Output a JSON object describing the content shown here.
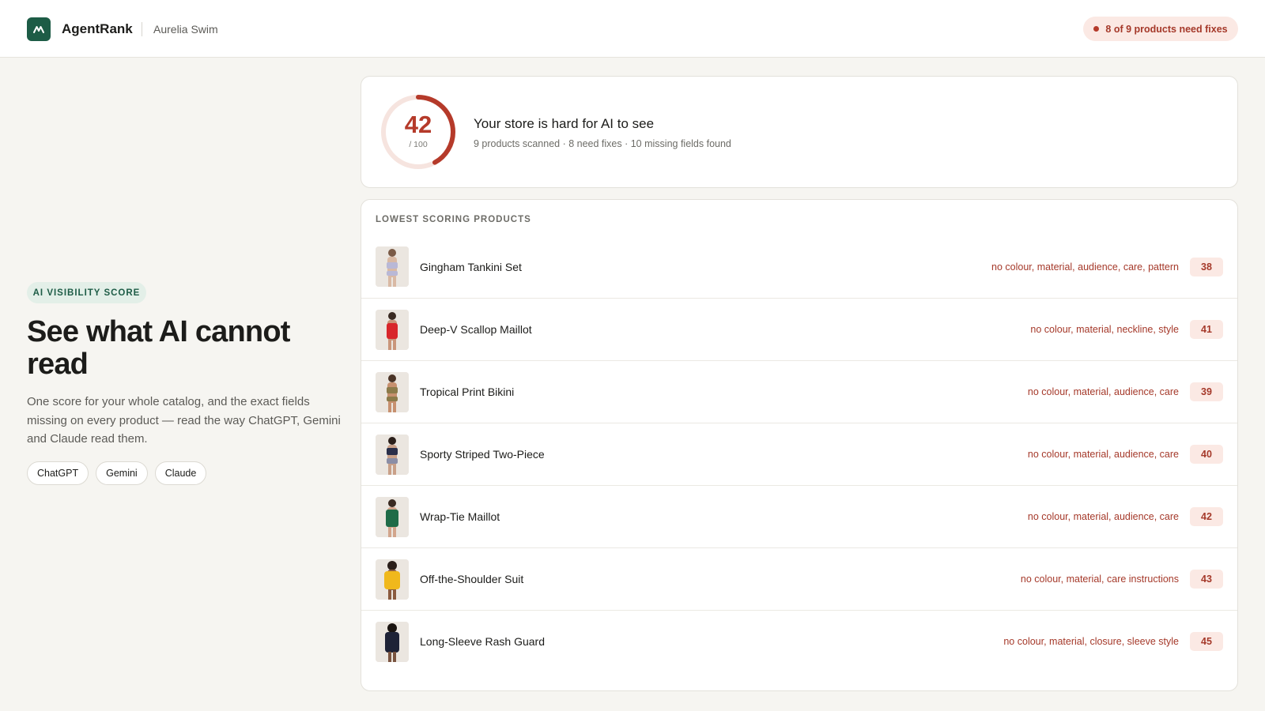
{
  "header": {
    "brand": "AgentRank",
    "store_name": "Aurelia Swim",
    "alert": "8 of 9 products need fixes"
  },
  "hero": {
    "eyebrow": "AI VISIBILITY SCORE",
    "title": "See what AI cannot read",
    "description": "One score for your whole catalog, and the exact fields missing on every product — read the way ChatGPT, Gemini and Claude read them.",
    "models": [
      "ChatGPT",
      "Gemini",
      "Claude"
    ]
  },
  "score": {
    "value": "42",
    "out_of": "/ 100",
    "fraction": 0.42,
    "headline": "Your store is hard for AI to see",
    "summary": "9 products scanned · 8 need fixes · 10 missing fields found"
  },
  "products": {
    "section_label": "LOWEST SCORING PRODUCTS",
    "items": [
      {
        "name": "Gingham Tankini Set",
        "missing": "no colour, material, audience, care, pattern",
        "score": "38",
        "swatch": "#b9b8d6"
      },
      {
        "name": "Deep-V Scallop Maillot",
        "missing": "no colour, material, neckline, style",
        "score": "41",
        "swatch": "#d8262b"
      },
      {
        "name": "Tropical Print Bikini",
        "missing": "no colour, material, audience, care",
        "score": "39",
        "swatch": "#8c7a4a"
      },
      {
        "name": "Sporty Striped Two-Piece",
        "missing": "no colour, material, audience, care",
        "score": "40",
        "swatch": "#2a2f4a"
      },
      {
        "name": "Wrap-Tie Maillot",
        "missing": "no colour, material, audience, care",
        "score": "42",
        "swatch": "#1f6b48"
      },
      {
        "name": "Off-the-Shoulder Suit",
        "missing": "no colour, material, care instructions",
        "score": "43",
        "swatch": "#f0b81c"
      },
      {
        "name": "Long-Sleeve Rash Guard",
        "missing": "no colour, material, closure, sleeve style",
        "score": "45",
        "swatch": "#1e2236"
      }
    ]
  },
  "colors": {
    "brand_green": "#1d5c46",
    "alert_red": "#b53a2a",
    "alert_bg": "#fbe9e4"
  }
}
